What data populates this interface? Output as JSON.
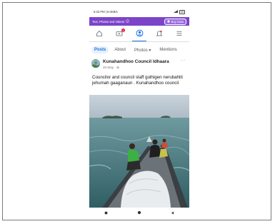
{
  "status_bar": {
    "time": "5:33 PM | 8.0KB/s",
    "battery": "58"
  },
  "banner": {
    "text": "Text, Photos and Videos",
    "button_label": "Buy Data"
  },
  "navbar": {
    "items": [
      {
        "icon": "home-icon"
      },
      {
        "icon": "video-icon",
        "badge": "2"
      },
      {
        "icon": "profile-icon"
      },
      {
        "icon": "notifications-icon"
      },
      {
        "icon": "menu-icon"
      }
    ]
  },
  "tabs": [
    "Posts",
    "About",
    "Photos ▾",
    "Mentions"
  ],
  "post": {
    "author": "Kunahandhoo Council Idhaara",
    "date": "20 May · ⊕",
    "more": "···",
    "text": "Councilor and council staff gulhigen nerubahtti jehumah gaaganaun . Kunahandhoo council"
  },
  "colors": {
    "banner": "#7b44c9",
    "accent": "#1b74e4",
    "badge": "#e41e3f"
  }
}
